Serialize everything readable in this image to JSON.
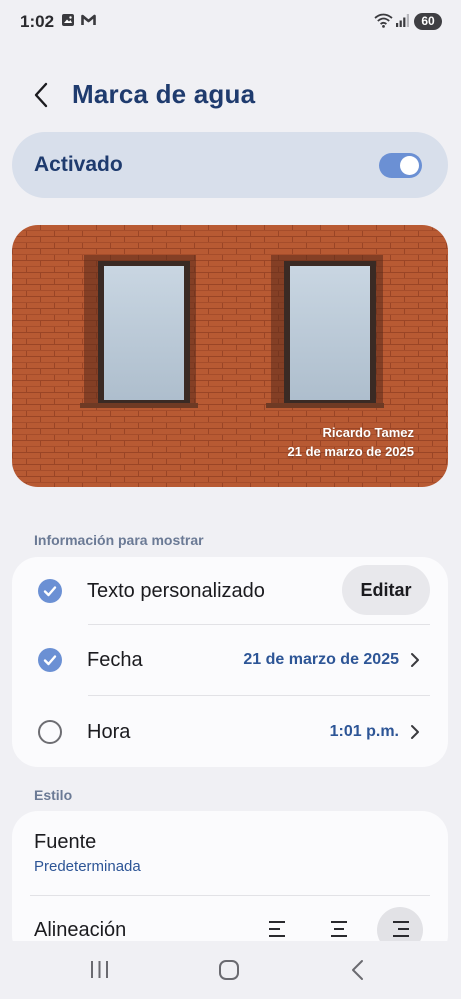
{
  "status_bar": {
    "time": "1:02",
    "battery": "60",
    "icons": [
      "gallery-notification-icon",
      "gmail-notification-icon",
      "wifi-icon",
      "signal-icon",
      "battery-icon"
    ]
  },
  "header": {
    "title": "Marca de agua",
    "back_icon": "back-arrow-icon"
  },
  "master_switch": {
    "label": "Activado",
    "state": "on",
    "accent": "#6b90d4"
  },
  "preview": {
    "name": "Ricardo Tamez",
    "date": "21 de marzo de 2025"
  },
  "info_section": {
    "label": "Información para mostrar",
    "rows": [
      {
        "title": "Texto personalizado",
        "checked": true,
        "action": "Editar"
      },
      {
        "title": "Fecha",
        "checked": true,
        "value": "21 de marzo de 2025"
      },
      {
        "title": "Hora",
        "checked": false,
        "value": "1:01 p.m."
      }
    ]
  },
  "style_section": {
    "label": "Estilo",
    "font": {
      "title": "Fuente",
      "value": "Predeterminada"
    },
    "alignment": {
      "title": "Alineación",
      "options": [
        "left",
        "center",
        "right"
      ],
      "selected": "right"
    }
  },
  "nav_bar": {
    "icons": [
      "recent-apps-icon",
      "home-icon",
      "back-icon"
    ]
  },
  "colors": {
    "title_blue": "#1f3b6e",
    "value_blue": "#2d5596",
    "accent": "#6b90d4",
    "background": "#f0f0f4"
  }
}
